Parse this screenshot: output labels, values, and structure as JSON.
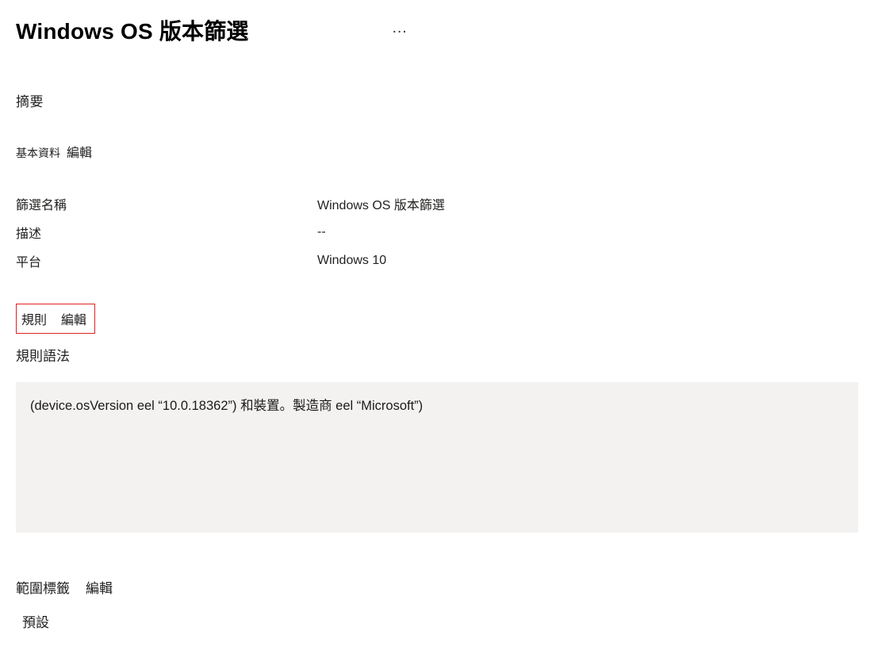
{
  "header": {
    "title": "Windows OS 版本篩選",
    "more_icon_label": "…"
  },
  "summary": {
    "label": "摘要"
  },
  "basics": {
    "label": "基本資料",
    "edit_label": "編輯",
    "rows": {
      "filter_name": {
        "key": "篩選名稱",
        "value": "Windows OS 版本篩選"
      },
      "description": {
        "key": "描述",
        "value": "--"
      },
      "platform": {
        "key": "平台",
        "value": "Windows 10"
      }
    }
  },
  "rules": {
    "label": "規則",
    "edit_label": "編輯",
    "syntax_label": "規則語法",
    "syntax_text": "(device.osVersion eel “10.0.18362”) 和裝置。製造商 eel “Microsoft”)"
  },
  "scope_tags": {
    "label": "範圍標籤",
    "edit_label": "編輯",
    "value": "預設"
  }
}
